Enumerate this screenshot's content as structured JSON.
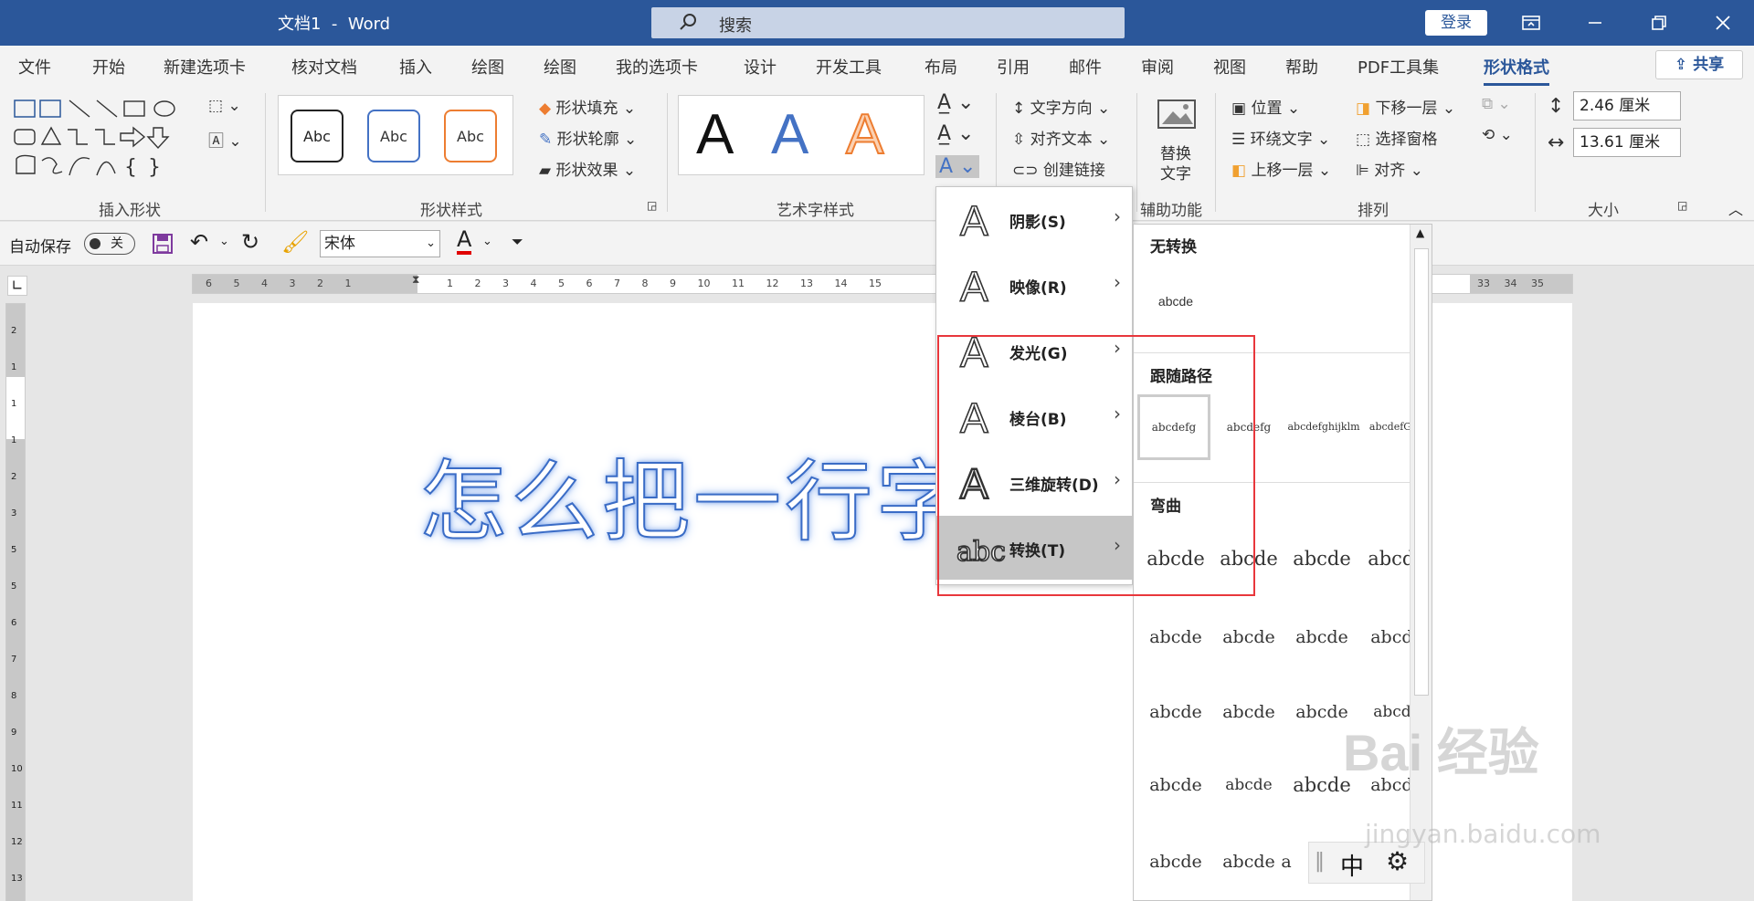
{
  "titlebar": {
    "doc_title": "文档1  -  Word",
    "search_placeholder": "搜索",
    "login_label": "登录"
  },
  "tabs": [
    "文件",
    "开始",
    "新建选项卡",
    "核对文档",
    "插入",
    "绘图",
    "绘图",
    "我的选项卡",
    "设计",
    "开发工具",
    "布局",
    "引用",
    "邮件",
    "审阅",
    "视图",
    "帮助",
    "PDF工具集",
    "形状格式"
  ],
  "active_tab": "形状格式",
  "share_label": "共享",
  "ribbon": {
    "groups": {
      "insert_shapes": "插入形状",
      "shape_styles": "形状样式",
      "wordart_styles": "艺术字样式",
      "accessibility": "辅助功能",
      "arrange": "排列",
      "size": "大小"
    },
    "shape_style_samples": [
      "Abc",
      "Abc",
      "Abc"
    ],
    "shape_fill": "形状填充",
    "shape_outline": "形状轮廓",
    "shape_effects": "形状效果",
    "wordart_sample": "A",
    "text_direction": "文字方向",
    "align_text": "对齐文本",
    "create_link": "创建链接",
    "alt_text_line1": "替换",
    "alt_text_line2": "文字",
    "position": "位置",
    "wrap_text": "环绕文字",
    "bring_forward": "上移一层",
    "send_backward": "下移一层",
    "selection_pane": "选择窗格",
    "align": "对齐",
    "height": "2.46 厘米",
    "width": "13.61 厘米"
  },
  "qat": {
    "autosave_label": "自动保存",
    "autosave_state": "关",
    "font_name": "宋体",
    "font_color_glyph": "A"
  },
  "ruler": {
    "left_ticks": [
      "6",
      "5",
      "4",
      "3",
      "2",
      "1"
    ],
    "right_ticks": [
      "1",
      "2",
      "3",
      "4",
      "5",
      "6",
      "7",
      "8",
      "9",
      "10",
      "11",
      "12",
      "13",
      "14",
      "15"
    ],
    "far_ticks": [
      "33",
      "34",
      "35"
    ],
    "vertical_ticks": [
      "2",
      "1",
      "1",
      "1",
      "2",
      "3",
      "5",
      "5",
      "6",
      "7",
      "8",
      "9",
      "10",
      "11",
      "12",
      "13"
    ]
  },
  "document": {
    "wordart_text": "怎么把一行字"
  },
  "menu": {
    "items": [
      {
        "label": "阴影(S)",
        "icon": "text-shadow-icon"
      },
      {
        "label": "映像(R)",
        "icon": "text-reflection-icon"
      },
      {
        "label": "发光(G)",
        "icon": "text-glow-icon"
      },
      {
        "label": "棱台(B)",
        "icon": "text-bevel-icon"
      },
      {
        "label": "三维旋转(D)",
        "icon": "text-3d-rotation-icon"
      },
      {
        "label": "转换(T)",
        "icon": "text-transform-icon"
      }
    ],
    "active_index": 5
  },
  "gallery": {
    "no_transform": "无转换",
    "no_transform_sample": "abcde",
    "follow_path": "跟随路径",
    "follow_path_samples": [
      "abcdefg",
      "abcdefg",
      "abcdefghijklm",
      "abcdefGhij"
    ],
    "warp": "弯曲",
    "warp_samples": [
      "abcde",
      "abcde",
      "abcde",
      "abcde",
      "abcde",
      "abcde",
      "abcde",
      "abcde",
      "abcde",
      "abcde",
      "abcde",
      "abcde",
      "abcde",
      "abcde",
      "abcde",
      "abcde",
      "abcde",
      "abcde",
      "a",
      "e"
    ]
  },
  "ime": {
    "label": "中"
  },
  "watermark": {
    "main": "Bai 经验",
    "sub": "jingyan.baidu.com"
  },
  "colors": {
    "title_bar": "#2b579a",
    "highlight": "#e8373c",
    "wordart_outline": "#3a6cc6"
  }
}
